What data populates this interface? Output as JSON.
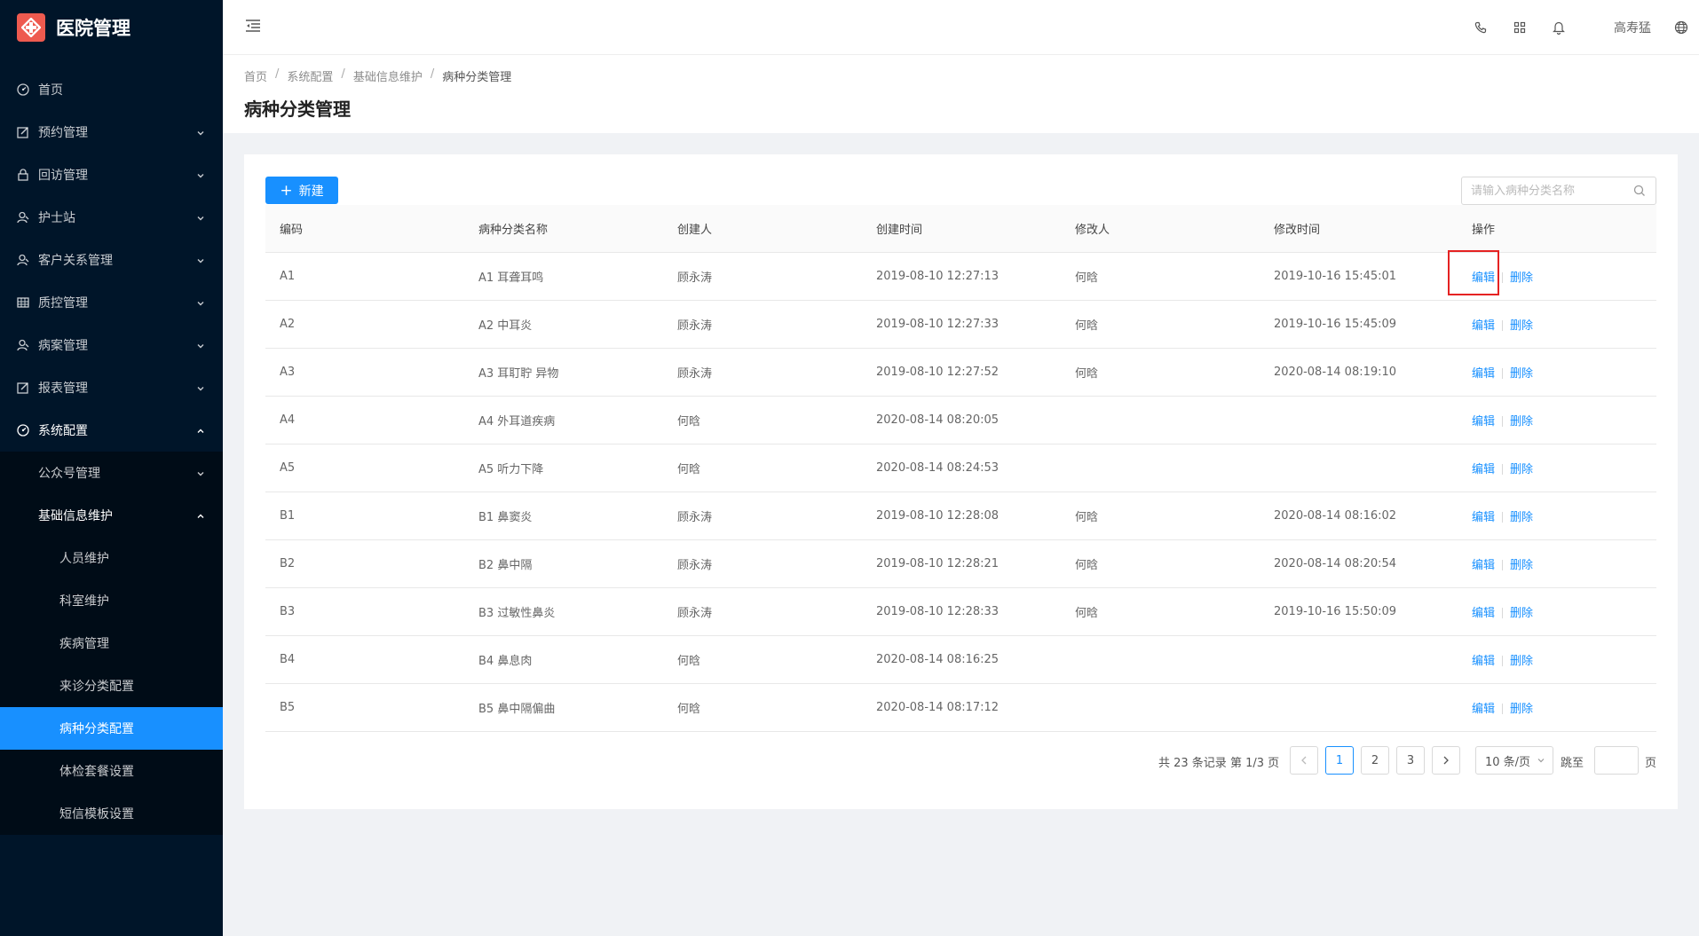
{
  "app": {
    "title": "医院管理"
  },
  "sidebar": {
    "items": [
      {
        "label": "首页",
        "icon": "dashboard-icon"
      },
      {
        "label": "预约管理",
        "icon": "edit-icon"
      },
      {
        "label": "回访管理",
        "icon": "lock-icon"
      },
      {
        "label": "护士站",
        "icon": "user-icon"
      },
      {
        "label": "客户关系管理",
        "icon": "user-icon"
      },
      {
        "label": "质控管理",
        "icon": "table-icon"
      },
      {
        "label": "病案管理",
        "icon": "user-icon"
      },
      {
        "label": "报表管理",
        "icon": "edit-icon"
      },
      {
        "label": "系统配置",
        "icon": "dashboard-icon"
      }
    ],
    "system_sub": [
      {
        "label": "公众号管理"
      },
      {
        "label": "基础信息维护"
      }
    ],
    "basic_sub": [
      {
        "label": "人员维护"
      },
      {
        "label": "科室维护"
      },
      {
        "label": "疾病管理"
      },
      {
        "label": "来诊分类配置"
      },
      {
        "label": "病种分类配置"
      },
      {
        "label": "体检套餐设置"
      },
      {
        "label": "短信模板设置"
      }
    ]
  },
  "header": {
    "username": "高寿猛"
  },
  "breadcrumb": [
    "首页",
    "系统配置",
    "基础信息维护",
    "病种分类管理"
  ],
  "page": {
    "title": "病种分类管理"
  },
  "toolbar": {
    "new_label": "新建",
    "search_placeholder": "请输入病种分类名称"
  },
  "table": {
    "columns": [
      "编码",
      "病种分类名称",
      "创建人",
      "创建时间",
      "修改人",
      "修改时间",
      "操作"
    ],
    "edit_label": "编辑",
    "delete_label": "删除",
    "rows": [
      {
        "code": "A1",
        "name": "A1 耳聋耳鸣",
        "creator": "顾永涛",
        "created": "2019-08-10 12:27:13",
        "modifier": "何晗",
        "modified": "2019-10-16 15:45:01"
      },
      {
        "code": "A2",
        "name": "A2 中耳炎",
        "creator": "顾永涛",
        "created": "2019-08-10 12:27:33",
        "modifier": "何晗",
        "modified": "2019-10-16 15:45:09"
      },
      {
        "code": "A3",
        "name": "A3 耳耵聍 异物",
        "creator": "顾永涛",
        "created": "2019-08-10 12:27:52",
        "modifier": "何晗",
        "modified": "2020-08-14 08:19:10"
      },
      {
        "code": "A4",
        "name": "A4 外耳道疾病",
        "creator": "何晗",
        "created": "2020-08-14 08:20:05",
        "modifier": "",
        "modified": ""
      },
      {
        "code": "A5",
        "name": "A5 听力下降",
        "creator": "何晗",
        "created": "2020-08-14 08:24:53",
        "modifier": "",
        "modified": ""
      },
      {
        "code": "B1",
        "name": "B1 鼻窦炎",
        "creator": "顾永涛",
        "created": "2019-08-10 12:28:08",
        "modifier": "何晗",
        "modified": "2020-08-14 08:16:02"
      },
      {
        "code": "B2",
        "name": "B2 鼻中隔",
        "creator": "顾永涛",
        "created": "2019-08-10 12:28:21",
        "modifier": "何晗",
        "modified": "2020-08-14 08:20:54"
      },
      {
        "code": "B3",
        "name": "B3 过敏性鼻炎",
        "creator": "顾永涛",
        "created": "2019-08-10 12:28:33",
        "modifier": "何晗",
        "modified": "2019-10-16 15:50:09"
      },
      {
        "code": "B4",
        "name": "B4 鼻息肉",
        "creator": "何晗",
        "created": "2020-08-14 08:16:25",
        "modifier": "",
        "modified": ""
      },
      {
        "code": "B5",
        "name": "B5 鼻中隔偏曲",
        "creator": "何晗",
        "created": "2020-08-14 08:17:12",
        "modifier": "",
        "modified": ""
      }
    ]
  },
  "pagination": {
    "total_text": "共 23 条记录 第 1/3 页",
    "pages": [
      "1",
      "2",
      "3"
    ],
    "current": "1",
    "page_size": "10 条/页",
    "jump_label": "跳至",
    "page_label": "页"
  },
  "colors": {
    "primary": "#1890ff",
    "sider": "#001529",
    "highlight": "#e52222",
    "logo": "#ee5a4f"
  }
}
